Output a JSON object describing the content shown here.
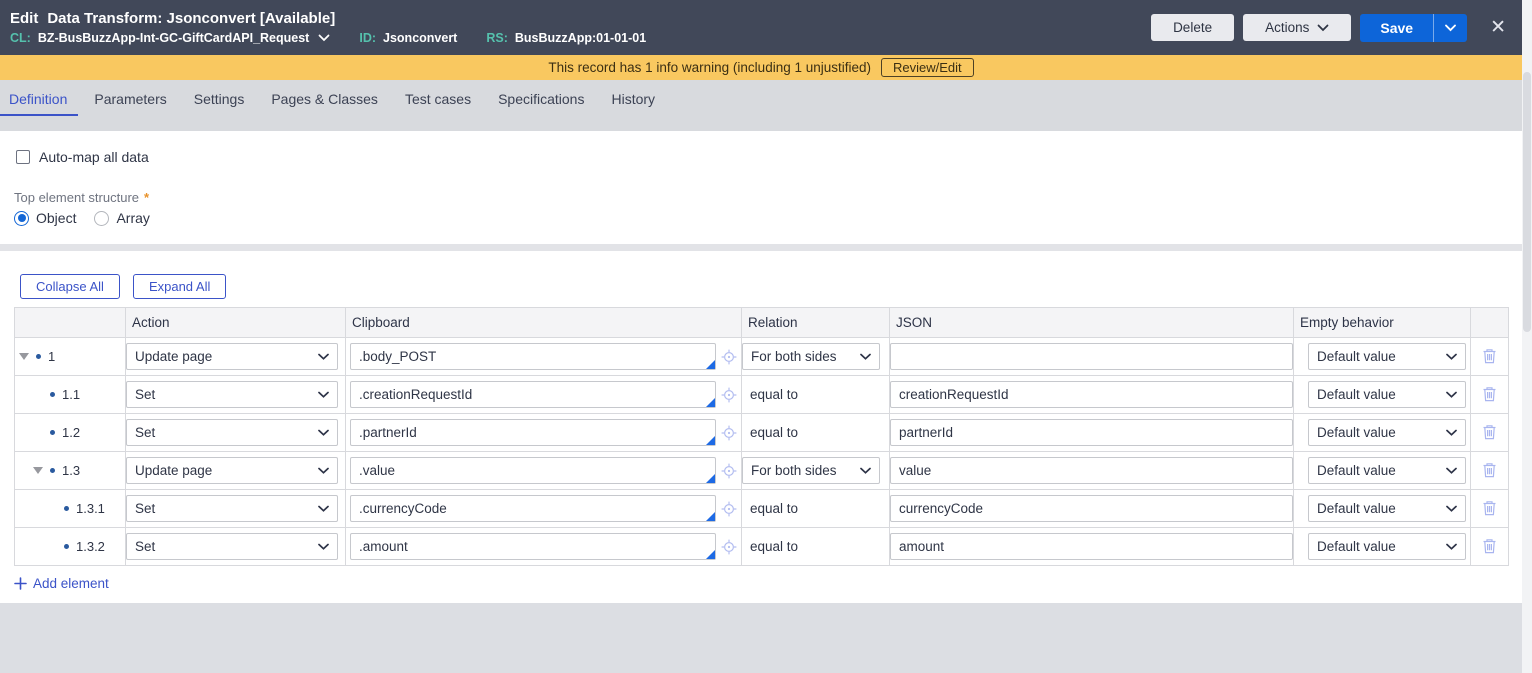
{
  "colors": {
    "header_bg": "#414859",
    "meta_teal": "#55c1ad",
    "banner_bg": "#f9c860",
    "accent_blue": "#3b53c8",
    "save_blue": "#0d65d9",
    "bullet_blue": "#2a5a9f",
    "icon_periwinkle": "#a9b5ef",
    "corner_blue": "#1d6ae5",
    "required_orange": "#e8922a"
  },
  "header": {
    "edit_label": "Edit",
    "title": "Data Transform: Jsonconvert [Available]",
    "meta": {
      "cl_label": "CL:",
      "cl_value": "BZ-BusBuzzApp-Int-GC-GiftCardAPI_Request",
      "id_label": "ID:",
      "id_value": "Jsonconvert",
      "rs_label": "RS:",
      "rs_value": "BusBuzzApp:01-01-01"
    },
    "buttons": {
      "delete": "Delete",
      "actions": "Actions",
      "save": "Save"
    }
  },
  "banner": {
    "text": "This record has 1 info warning (including 1 unjustified)",
    "review_button": "Review/Edit"
  },
  "tabs": [
    {
      "label": "Definition",
      "active": true
    },
    {
      "label": "Parameters",
      "active": false
    },
    {
      "label": "Settings",
      "active": false
    },
    {
      "label": "Pages & Classes",
      "active": false
    },
    {
      "label": "Test cases",
      "active": false
    },
    {
      "label": "Specifications",
      "active": false
    },
    {
      "label": "History",
      "active": false
    }
  ],
  "form": {
    "automap_label": "Auto-map all data",
    "automap_checked": false,
    "top_element_label": "Top element structure",
    "required_marker": "*",
    "radio_object": "Object",
    "radio_array": "Array",
    "selected": "Object"
  },
  "toolbar": {
    "collapse": "Collapse All",
    "expand": "Expand All"
  },
  "table": {
    "columns": [
      "",
      "Action",
      "Clipboard",
      "Relation",
      "JSON",
      "Empty behavior",
      ""
    ],
    "rows": [
      {
        "num": "1",
        "level": 0,
        "expander": true,
        "action": "Update page",
        "clipboard": ".body_POST",
        "relation": "For both sides",
        "relation_select": true,
        "json": "",
        "empty": "Default value"
      },
      {
        "num": "1.1",
        "level": 1,
        "expander": false,
        "action": "Set",
        "clipboard": ".creationRequestId",
        "relation": "equal to",
        "relation_select": false,
        "json": "creationRequestId",
        "empty": "Default value"
      },
      {
        "num": "1.2",
        "level": 1,
        "expander": false,
        "action": "Set",
        "clipboard": ".partnerId",
        "relation": "equal to",
        "relation_select": false,
        "json": "partnerId",
        "empty": "Default value"
      },
      {
        "num": "1.3",
        "level": 1,
        "expander": true,
        "action": "Update page",
        "clipboard": ".value",
        "relation": "For both sides",
        "relation_select": true,
        "json": "value",
        "empty": "Default value"
      },
      {
        "num": "1.3.1",
        "level": 2,
        "expander": false,
        "action": "Set",
        "clipboard": ".currencyCode",
        "relation": "equal to",
        "relation_select": false,
        "json": "currencyCode",
        "empty": "Default value"
      },
      {
        "num": "1.3.2",
        "level": 2,
        "expander": false,
        "action": "Set",
        "clipboard": ".amount",
        "relation": "equal to",
        "relation_select": false,
        "json": "amount",
        "empty": "Default value"
      }
    ]
  },
  "footer": {
    "add_element": "Add element"
  },
  "icons": [
    "chevron-down-icon",
    "close-icon",
    "trash-icon",
    "target-icon",
    "plus-icon",
    "expander-triangle-icon",
    "bullet-icon",
    "resize-corner-icon"
  ]
}
